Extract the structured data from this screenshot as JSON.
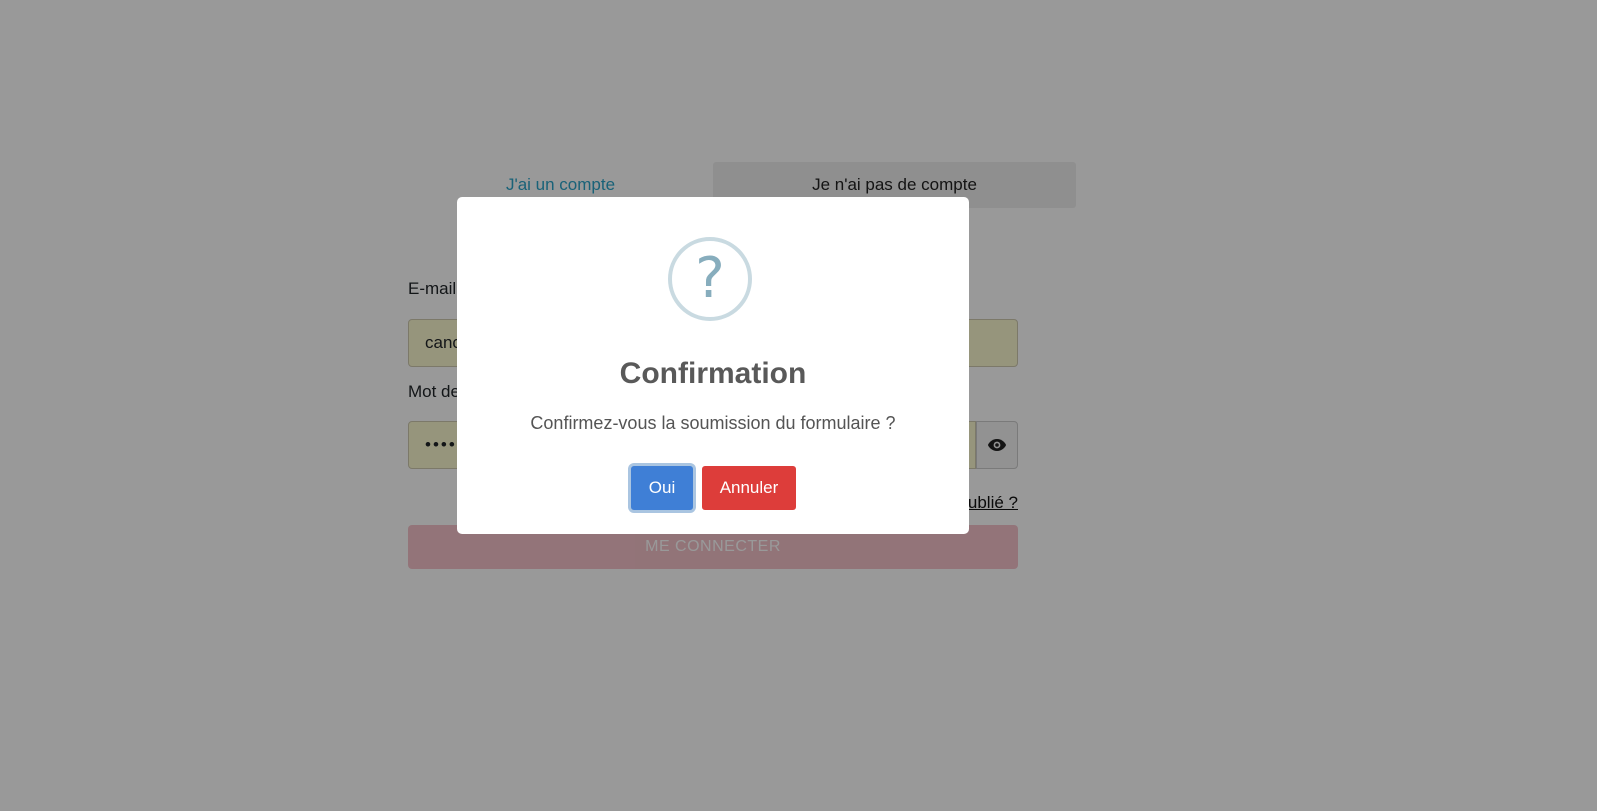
{
  "tabs": {
    "have_account": "J'ai un compte",
    "no_account": "Je n'ai pas de compte"
  },
  "form": {
    "email_label": "E-mail",
    "email_value": "canc",
    "password_label": "Mot de",
    "password_value": "•••••",
    "forgot_link": "ublié ?",
    "submit_label": "ME CONNECTER"
  },
  "modal": {
    "icon": "question-icon",
    "icon_glyph": "?",
    "title": "Confirmation",
    "text": "Confirmez-vous la soumission du formulaire ?",
    "confirm_label": "Oui",
    "cancel_label": "Annuler"
  },
  "colors": {
    "confirm": "#3f7fd6",
    "cancel": "#dd3d3a",
    "tab_link": "#2aa3c9"
  }
}
